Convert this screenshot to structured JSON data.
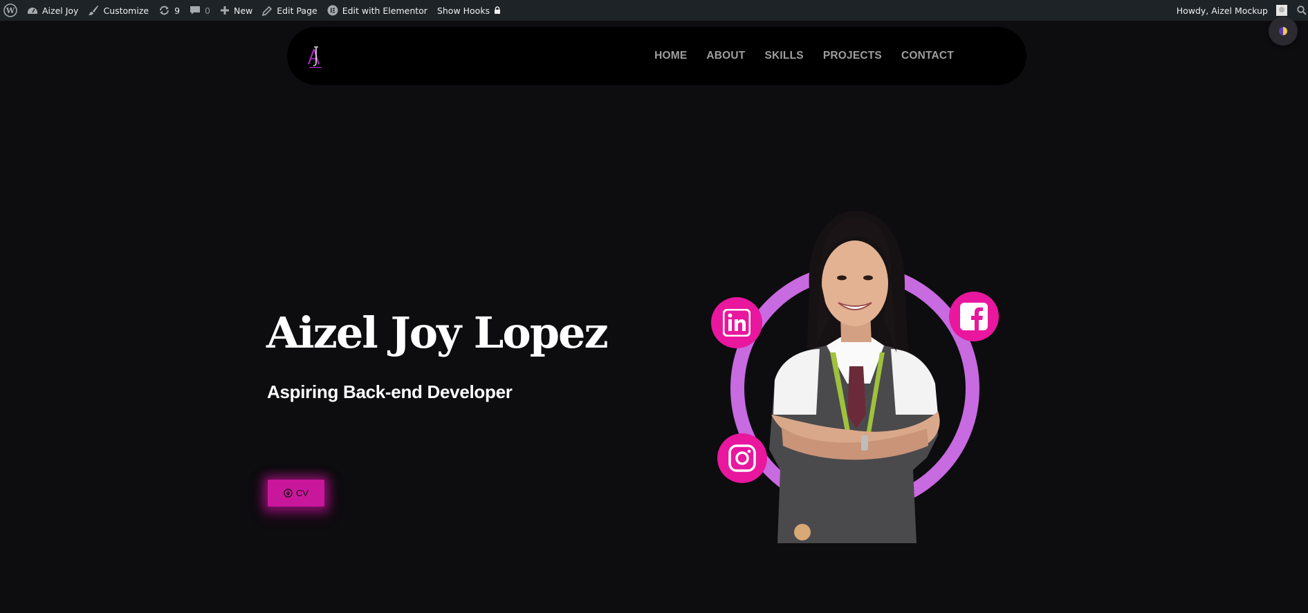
{
  "adminbar": {
    "site_name": "Aizel Joy",
    "customize": "Customize",
    "updates_count": "9",
    "comments_count": "0",
    "new": "New",
    "edit_page": "Edit Page",
    "edit_elementor": "Edit with Elementor",
    "show_hooks": "Show Hooks",
    "howdy": "Howdy, Aizel Mockup"
  },
  "nav": {
    "items": [
      "HOME",
      "ABOUT",
      "SKILLS",
      "PROJECTS",
      "CONTACT"
    ]
  },
  "hero": {
    "name": "Aizel Joy Lopez",
    "role": "Aspiring Back-end Developer",
    "cv_label": "CV"
  },
  "icons": {
    "wordpress": "wordpress-icon",
    "dashboard": "dashboard-icon",
    "brush": "brush-icon",
    "updates": "updates-icon",
    "comments": "comment-icon",
    "plus": "plus-icon",
    "pencil": "pencil-icon",
    "elementor": "elementor-icon",
    "lock": "lock-icon",
    "search": "search-icon",
    "theme": "theme-toggle-icon",
    "download": "download-icon",
    "linkedin": "linkedin-icon",
    "facebook": "facebook-icon",
    "instagram": "instagram-icon"
  },
  "colors": {
    "accent": "#e8179e",
    "ring": "#c86ae0",
    "background": "#0d0c0f",
    "adminbar": "#1d2327"
  }
}
